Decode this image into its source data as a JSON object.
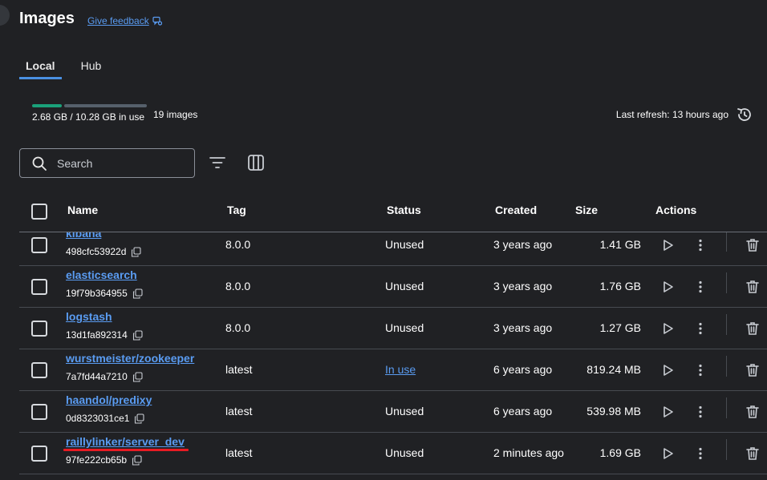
{
  "page": {
    "title": "Images",
    "feedback_label": "Give feedback"
  },
  "tabs": [
    {
      "label": "Local",
      "active": true
    },
    {
      "label": "Hub",
      "active": false
    }
  ],
  "usage": {
    "text": "2.68 GB / 10.28 GB in use",
    "used_fraction": 0.26,
    "image_count": "19 images"
  },
  "refresh": {
    "label": "Last refresh: 13 hours ago"
  },
  "search": {
    "placeholder": "Search",
    "value": ""
  },
  "table": {
    "columns": [
      "Name",
      "Tag",
      "Status",
      "Created",
      "Size",
      "Actions"
    ],
    "rows": [
      {
        "name": "kibana",
        "id": "498cfc53922d",
        "tag": "8.0.0",
        "status": "Unused",
        "created": "3 years ago",
        "size": "1.41 GB"
      },
      {
        "name": "elasticsearch",
        "id": "19f79b364955",
        "tag": "8.0.0",
        "status": "Unused",
        "created": "3 years ago",
        "size": "1.76 GB"
      },
      {
        "name": "logstash",
        "id": "13d1fa892314",
        "tag": "8.0.0",
        "status": "Unused",
        "created": "3 years ago",
        "size": "1.27 GB"
      },
      {
        "name": "wurstmeister/zookeeper",
        "id": "7a7fd44a7210",
        "tag": "latest",
        "status": "In use",
        "created": "6 years ago",
        "size": "819.24 MB"
      },
      {
        "name": "haandol/predixy",
        "id": "0d8323031ce1",
        "tag": "latest",
        "status": "Unused",
        "created": "6 years ago",
        "size": "539.98 MB"
      },
      {
        "name": "raillylinker/server_dev",
        "id": "97fe222cb65b",
        "tag": "latest",
        "status": "Unused",
        "created": "2 minutes ago",
        "size": "1.69 GB"
      }
    ]
  },
  "colors": {
    "background": "#202124",
    "link": "#5a9cf2",
    "usage_used": "#1aa17a",
    "tab_indicator": "#4a90e2",
    "annotation_underline": "#e81b23"
  },
  "icons": {
    "feedback": "feedback-icon",
    "refresh": "refresh-icon",
    "search": "search-icon",
    "filter": "filter-icon",
    "columns": "columns-icon",
    "copy": "copy-icon",
    "run": "play-icon",
    "more": "more-vertical-icon",
    "delete": "trash-icon"
  }
}
